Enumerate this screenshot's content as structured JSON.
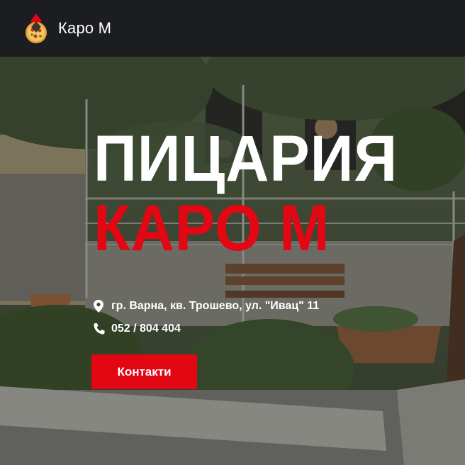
{
  "navbar": {
    "brand_name": "Каро М",
    "logo_icon": "pizza-logo-icon"
  },
  "hero": {
    "title_line1": "ПИЦАРИЯ",
    "title_line2": "КАРО М",
    "address": "гр. Варна, кв. Трошево, ул. \"Ивац\" 11",
    "address_icon": "map-marker-icon",
    "phone": "052 / 804 404",
    "phone_icon": "phone-icon",
    "contact_button": "Контакти",
    "background": "restaurant-terrace-photo"
  },
  "colors": {
    "navbar_bg": "#1b1d21",
    "accent_red": "#e30613",
    "text_white": "#ffffff"
  }
}
